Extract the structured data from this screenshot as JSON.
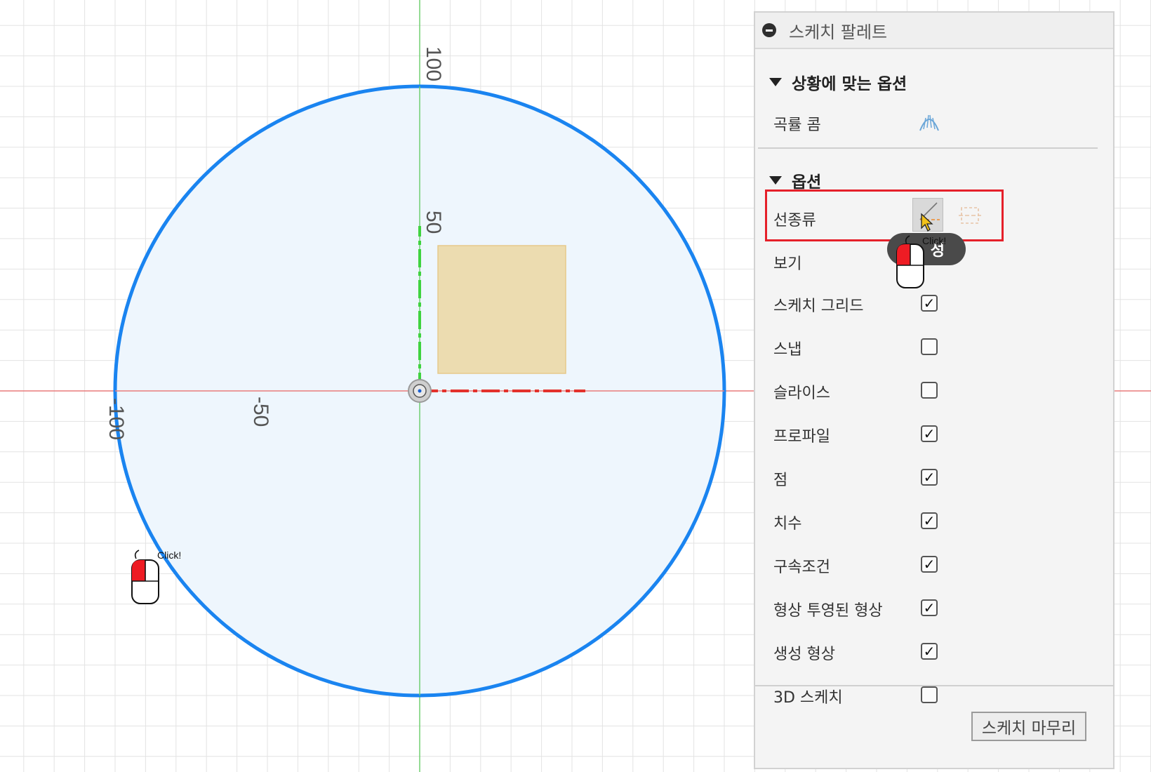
{
  "viewport": {
    "axis_labels": {
      "y_top": "100",
      "y_mid": "50",
      "x_left": "-100",
      "x_mid": "-50"
    },
    "cursor_label": "Click!",
    "colors": {
      "circle_stroke": "#1a84f0",
      "circle_fill": "#eef6fd",
      "x_axis": "#e33b3b",
      "y_axis": "#3cc53c",
      "rectangle_fill": "#ecdcb0",
      "grid": "#e3e3e3"
    }
  },
  "palette": {
    "title": "스케치 팔레트",
    "section_contextual": {
      "title": "상황에 맞는 옵션",
      "rows": [
        {
          "label": "곡률 콤",
          "icon": "curvature-comb-icon"
        }
      ]
    },
    "section_options": {
      "title": "옵션",
      "linetype": {
        "label": "선종류",
        "icons": [
          "construction-line-icon",
          "centerline-icon"
        ],
        "cursor_label": "Click!"
      },
      "view": {
        "label": "보기",
        "button_label": "성"
      },
      "checkboxes": [
        {
          "label": "스케치 그리드",
          "checked": true
        },
        {
          "label": "스냅",
          "checked": false
        },
        {
          "label": "슬라이스",
          "checked": false
        },
        {
          "label": "프로파일",
          "checked": true
        },
        {
          "label": "점",
          "checked": true
        },
        {
          "label": "치수",
          "checked": true
        },
        {
          "label": "구속조건",
          "checked": true
        },
        {
          "label": "형상 투영된 형상",
          "checked": true
        },
        {
          "label": "생성 형상",
          "checked": true
        },
        {
          "label": "3D 스케치",
          "checked": false
        }
      ]
    },
    "finish_button": "스케치 마무리",
    "accent_highlight": "#e5202a"
  }
}
